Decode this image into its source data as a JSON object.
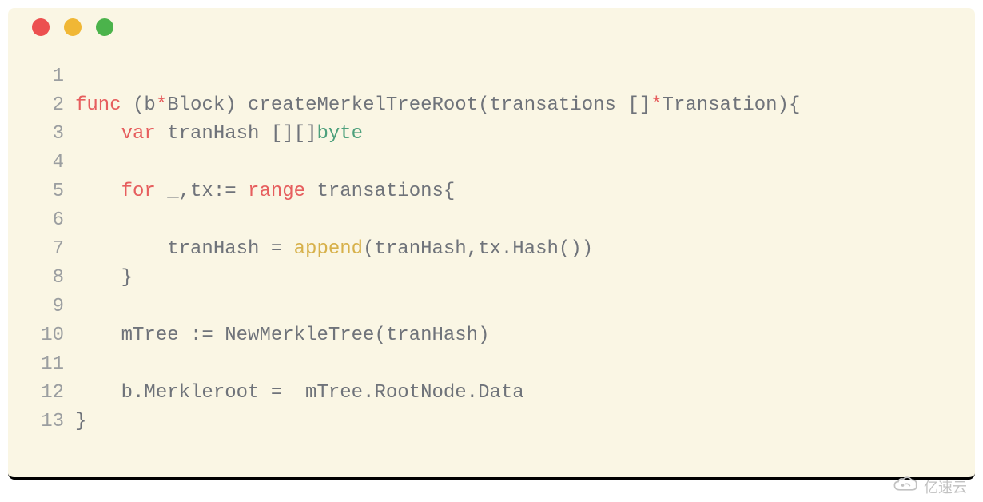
{
  "window": {
    "dots": [
      "red",
      "yellow",
      "green"
    ]
  },
  "code": {
    "lines": [
      {
        "num": "1",
        "tokens": []
      },
      {
        "num": "2",
        "tokens": [
          {
            "t": "func ",
            "c": "kw"
          },
          {
            "t": "(",
            "c": "punct"
          },
          {
            "t": "b",
            "c": "ident"
          },
          {
            "t": "*",
            "c": "kw"
          },
          {
            "t": "Block",
            "c": "ident"
          },
          {
            "t": ") createMerkelTreeRoot(transations []",
            "c": "punct"
          },
          {
            "t": "*",
            "c": "kw"
          },
          {
            "t": "Transation){",
            "c": "punct"
          }
        ]
      },
      {
        "num": "3",
        "tokens": [
          {
            "t": "    ",
            "c": "punct"
          },
          {
            "t": "var ",
            "c": "kw"
          },
          {
            "t": "tranHash [][]",
            "c": "ident"
          },
          {
            "t": "byte",
            "c": "typename"
          }
        ]
      },
      {
        "num": "4",
        "tokens": []
      },
      {
        "num": "5",
        "tokens": [
          {
            "t": "    ",
            "c": "punct"
          },
          {
            "t": "for ",
            "c": "kw"
          },
          {
            "t": "_,tx:= ",
            "c": "ident"
          },
          {
            "t": "range ",
            "c": "kw"
          },
          {
            "t": "transations{",
            "c": "ident"
          }
        ]
      },
      {
        "num": "6",
        "tokens": []
      },
      {
        "num": "7",
        "tokens": [
          {
            "t": "        tranHash = ",
            "c": "ident"
          },
          {
            "t": "append",
            "c": "builtin"
          },
          {
            "t": "(tranHash,tx.Hash())",
            "c": "ident"
          }
        ]
      },
      {
        "num": "8",
        "tokens": [
          {
            "t": "    }",
            "c": "punct"
          }
        ]
      },
      {
        "num": "9",
        "tokens": []
      },
      {
        "num": "10",
        "tokens": [
          {
            "t": "    mTree := NewMerkleTree(tranHash)",
            "c": "ident"
          }
        ]
      },
      {
        "num": "11",
        "tokens": []
      },
      {
        "num": "12",
        "tokens": [
          {
            "t": "    b.Merkleroot =  mTree.RootNode.Data",
            "c": "ident"
          }
        ]
      },
      {
        "num": "13",
        "tokens": [
          {
            "t": "}",
            "c": "punct"
          }
        ]
      }
    ]
  },
  "watermark": {
    "text": "亿速云",
    "icon": "cloud-icon"
  }
}
